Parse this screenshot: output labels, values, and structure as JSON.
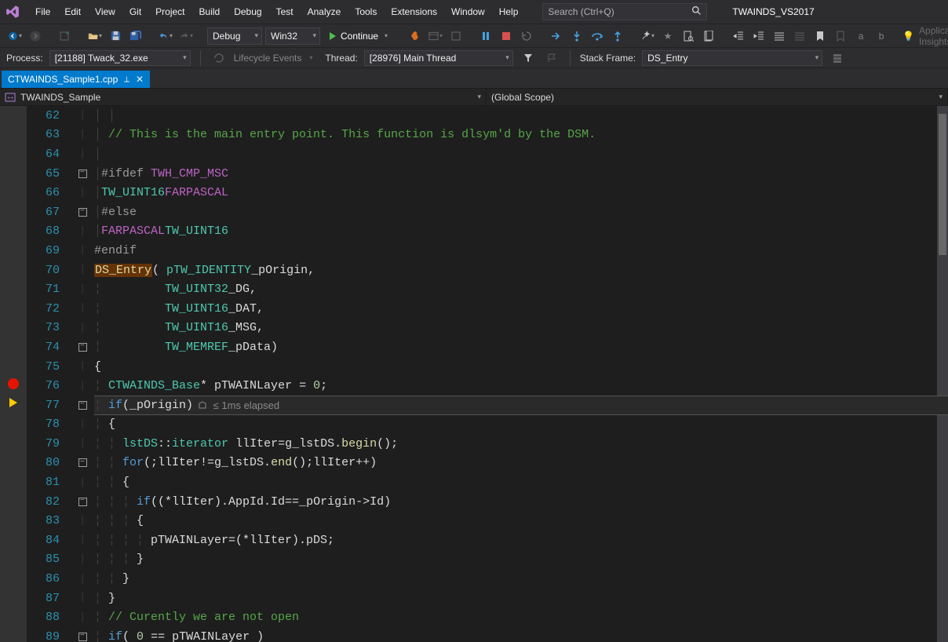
{
  "solution_name": "TWAINDS_VS2017",
  "search_placeholder": "Search (Ctrl+Q)",
  "menu": [
    "File",
    "Edit",
    "View",
    "Git",
    "Project",
    "Build",
    "Debug",
    "Test",
    "Analyze",
    "Tools",
    "Extensions",
    "Window",
    "Help"
  ],
  "toolbar": {
    "config": "Debug",
    "platform": "Win32",
    "continue_label": "Continue",
    "app_insights": "Application Insights"
  },
  "debugbar": {
    "process_label": "Process:",
    "process_value": "[21188] Twack_32.exe",
    "lifecycle_label": "Lifecycle Events",
    "thread_label": "Thread:",
    "thread_value": "[28976] Main Thread",
    "stack_label": "Stack Frame:",
    "stack_value": "DS_Entry"
  },
  "tabs": [
    {
      "title": "CTWAINDS_Sample1.cpp",
      "pinned": true,
      "active": true
    }
  ],
  "nav": {
    "project": "TWAINDS_Sample",
    "scope": "(Global Scope)"
  },
  "editor": {
    "breakpoint_line": 76,
    "current_line": 77,
    "perf_tip": "≤ 1ms elapsed",
    "lines": [
      {
        "n": 62,
        "fold": "",
        "html": "<span class='guide'>│ │</span>"
      },
      {
        "n": 63,
        "fold": "",
        "html": "<span class='guide'>│ </span><span class='tok-comment'>// This is the main entry point. This function is dlsym'd by the DSM.</span>"
      },
      {
        "n": 64,
        "fold": "",
        "html": "<span class='guide'>│</span>"
      },
      {
        "n": 65,
        "fold": "-",
        "html": "<span class='guide'>│</span><span class='tok-pp'>#ifdef </span><span class='tok-macro'>TWH_CMP_MSC</span>"
      },
      {
        "n": 66,
        "fold": "",
        "html": "<span class='guide'>│</span><span class='tok-type'>TW_UINT16</span> <span class='tok-macro'>FAR</span> <span class='tok-macro'>PASCAL</span>"
      },
      {
        "n": 67,
        "fold": "-",
        "html": "<span class='guide'>│</span><span class='tok-pp'>#else</span>"
      },
      {
        "n": 68,
        "fold": "",
        "html": "<span class='guide'>│</span><span class='tok-macro'>FAR</span> <span class='tok-macro'>PASCAL</span> <span class='tok-type'>TW_UINT16</span>"
      },
      {
        "n": 69,
        "fold": "",
        "html": " <span class='tok-pp'>#endif</span>"
      },
      {
        "n": 70,
        "fold": "",
        "html": " <span class='hl-ds'>DS_Entry</span><span class='tok-text'>( </span><span class='tok-type'>pTW_IDENTITY</span> <span class='tok-text'>_pOrigin,</span>"
      },
      {
        "n": 71,
        "fold": "",
        "html": " <span class='guide'>¦         </span><span class='tok-type'>TW_UINT32</span>    <span class='tok-text'>_DG,</span>"
      },
      {
        "n": 72,
        "fold": "",
        "html": " <span class='guide'>¦         </span><span class='tok-type'>TW_UINT16</span>    <span class='tok-text'>_DAT,</span>"
      },
      {
        "n": 73,
        "fold": "",
        "html": " <span class='guide'>¦         </span><span class='tok-type'>TW_UINT16</span>    <span class='tok-text'>_MSG,</span>"
      },
      {
        "n": 74,
        "fold": "-",
        "html": " <span class='guide'>¦         </span><span class='tok-type'>TW_MEMREF</span>    <span class='tok-text'>_pData)</span>"
      },
      {
        "n": 75,
        "fold": "",
        "html": " <span class='tok-text'>{</span>"
      },
      {
        "n": 76,
        "fold": "",
        "html": " <span class='guide'>¦ </span><span class='tok-type'>CTWAINDS_Base</span><span class='tok-text'>* pTWAINLayer = </span><span class='tok-num'>0</span><span class='tok-text'>;</span>"
      },
      {
        "n": 77,
        "fold": "-",
        "html": " <span class='guide'>¦ </span><span class='tok-kw'>if</span><span class='tok-text'>(_pOrigin)</span>"
      },
      {
        "n": 78,
        "fold": "",
        "html": " <span class='guide'>¦ </span><span class='tok-text'>{</span>"
      },
      {
        "n": 79,
        "fold": "",
        "html": " <span class='guide'>¦ ¦ </span><span class='tok-type'>lstDS</span><span class='tok-text'>::</span><span class='tok-type'>iterator</span><span class='tok-text'> llIter=g_lstDS.</span><span class='tok-func'>begin</span><span class='tok-text'>();</span>"
      },
      {
        "n": 80,
        "fold": "-",
        "html": " <span class='guide'>¦ ¦ </span><span class='tok-kw'>for</span><span class='tok-text'>(;llIter!=g_lstDS.</span><span class='tok-func'>end</span><span class='tok-text'>();llIter++)</span>"
      },
      {
        "n": 81,
        "fold": "",
        "html": " <span class='guide'>¦ ¦ </span><span class='tok-text'>{</span>"
      },
      {
        "n": 82,
        "fold": "-",
        "html": " <span class='guide'>¦ ¦ ¦ </span><span class='tok-kw'>if</span><span class='tok-text'>((*llIter).AppId.Id==_pOrigin-&gt;Id)</span>"
      },
      {
        "n": 83,
        "fold": "",
        "html": " <span class='guide'>¦ ¦ ¦ </span><span class='tok-text'>{</span>"
      },
      {
        "n": 84,
        "fold": "",
        "html": " <span class='guide'>¦ ¦ ¦ ¦ </span><span class='tok-text'>pTWAINLayer=(*llIter).pDS;</span>"
      },
      {
        "n": 85,
        "fold": "",
        "html": " <span class='guide'>¦ ¦ ¦ </span><span class='tok-text'>}</span>"
      },
      {
        "n": 86,
        "fold": "",
        "html": " <span class='guide'>¦ ¦ </span><span class='tok-text'>}</span>"
      },
      {
        "n": 87,
        "fold": "",
        "html": " <span class='guide'>¦ </span><span class='tok-text'>}</span>"
      },
      {
        "n": 88,
        "fold": "",
        "html": " <span class='guide'>¦ </span><span class='tok-comment'>// Curently we are not open</span>"
      },
      {
        "n": 89,
        "fold": "-",
        "html": " <span class='guide'>¦ </span><span class='tok-kw'>if</span><span class='tok-text'>( </span><span class='tok-num'>0</span><span class='tok-text'> == pTWAINLayer )</span>"
      }
    ]
  }
}
